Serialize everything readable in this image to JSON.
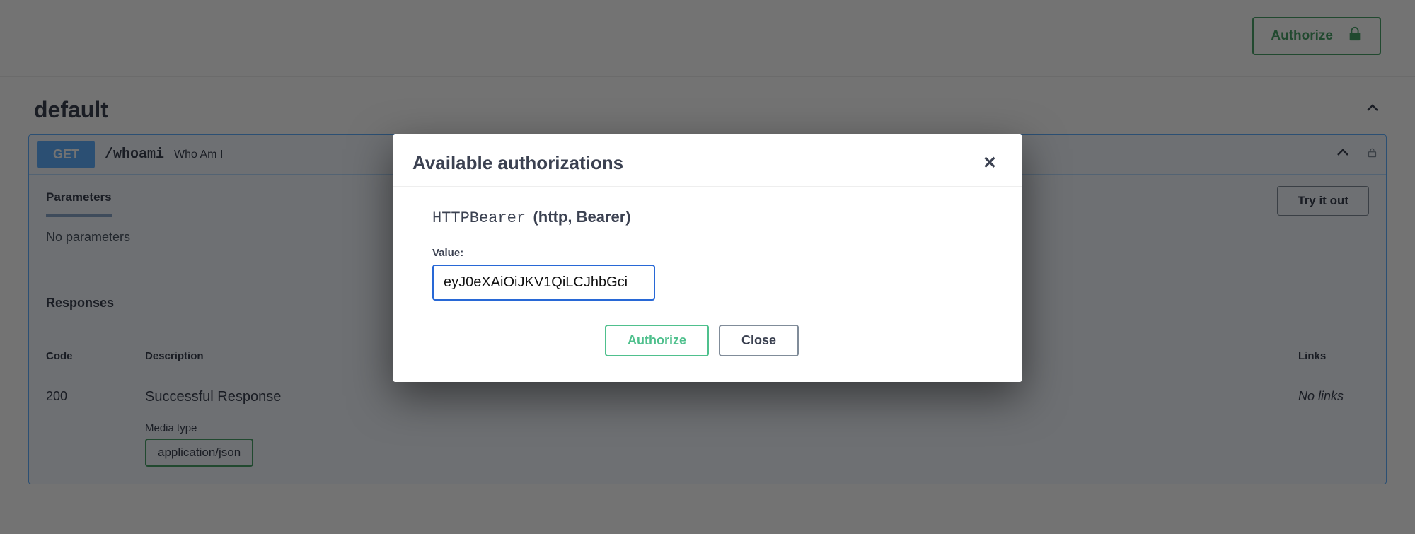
{
  "topbar": {
    "authorize_label": "Authorize"
  },
  "section_title": "default",
  "operation": {
    "method": "GET",
    "path": "/whoami",
    "summary": "Who Am I",
    "parameters_tab_label": "Parameters",
    "try_it_label": "Try it out",
    "no_parameters_text": "No parameters",
    "responses_label": "Responses",
    "table": {
      "code_header": "Code",
      "description_header": "Description",
      "links_header": "Links"
    },
    "response_row": {
      "code": "200",
      "description": "Successful Response",
      "links": "No links",
      "media_type_label": "Media type",
      "media_type_value": "application/json"
    }
  },
  "modal": {
    "title": "Available authorizations",
    "close_glyph": "✕",
    "scheme_name": "HTTPBearer",
    "scheme_type": "(http, Bearer)",
    "value_label": "Value:",
    "token_value": "eyJ0eXAiOiJKV1QiLCJhbGci",
    "authorize_label": "Authorize",
    "close_label": "Close"
  },
  "colors": {
    "accent_green": "#49a269",
    "accent_blue": "#61affe",
    "focus_blue": "#2868d6"
  }
}
